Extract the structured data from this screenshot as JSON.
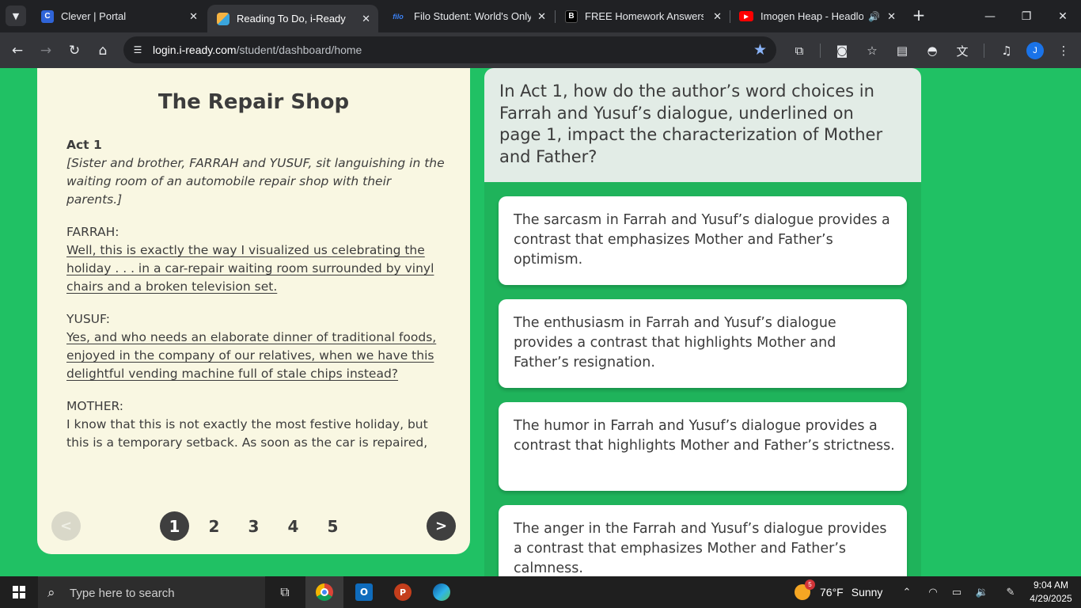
{
  "browser": {
    "tabs": [
      {
        "title": "Clever | Portal",
        "favicon": "C",
        "favicon_color": "#2f64d8",
        "active": false
      },
      {
        "title": "Reading To Do, i-Ready",
        "favicon": "",
        "favicon_color": "#f0a030",
        "active": true
      },
      {
        "title": "Filo Student: World's Only Li",
        "favicon": "filo",
        "favicon_color": "#1e3a8a",
        "active": false
      },
      {
        "title": "FREE Homework Answers fro",
        "favicon": "B",
        "favicon_color": "#000000",
        "active": false
      },
      {
        "title": "Imogen Heap - Headloc",
        "favicon": "▶",
        "favicon_color": "#ff0000",
        "active": false
      }
    ],
    "url_host": "login.i-ready.com",
    "url_path": "/student/dashboard/home",
    "profile_initial": "J"
  },
  "passage": {
    "title": "The Repair Shop",
    "act": "Act 1",
    "stage_direction": "[Sister and brother, FARRAH and YUSUF, sit languishing in the waiting room of an automobile repair shop with their parents.]",
    "lines": [
      {
        "speaker": "FARRAH:",
        "text": "Well, this is exactly the way I visualized us celebrating the holiday . . . in a car-repair waiting room surrounded by vinyl chairs and a broken television set.",
        "underlined": true
      },
      {
        "speaker": "YUSUF:",
        "text": "Yes, and who needs an elaborate dinner of traditional foods, enjoyed in the company of our relatives, when we have this delightful vending machine full of stale chips instead?",
        "underlined": true
      },
      {
        "speaker": "MOTHER:",
        "text": "I know that this is not exactly the most festive holiday, but this is a temporary setback. As soon as the car is repaired,",
        "underlined": false
      }
    ],
    "pager": {
      "prev": "<",
      "next": ">",
      "pages": [
        "1",
        "2",
        "3",
        "4",
        "5"
      ],
      "current": "1"
    }
  },
  "question": {
    "text": "In Act 1, how do the author’s word choices in Farrah and Yusuf’s dialogue, underlined on page 1, impact the characterization of Mother and Father?",
    "choices": [
      "The sarcasm in Farrah and Yusuf’s dialogue provides a contrast that emphasizes Mother and Father’s optimism.",
      "The enthusiasm in Farrah and Yusuf’s dialogue provides a contrast that highlights Mother and Father’s resignation.",
      "The humor in Farrah and Yusuf’s dialogue provides a contrast that highlights Mother and Father’s strictness.",
      "The anger in the Farrah and Yusuf’s dialogue provides a contrast that emphasizes Mother and Father’s calmness."
    ]
  },
  "taskbar": {
    "search_placeholder": "Type here to search",
    "weather_temp": "76°F",
    "weather_desc": "Sunny",
    "weather_badge": "5",
    "time": "9:04 AM",
    "date": "4/29/2025"
  },
  "colors": {
    "page_bg": "#20c164",
    "passage_bg": "#f9f7e2",
    "question_bg": "#e2ece6",
    "answer_panel_bg": "#1fb35b"
  }
}
